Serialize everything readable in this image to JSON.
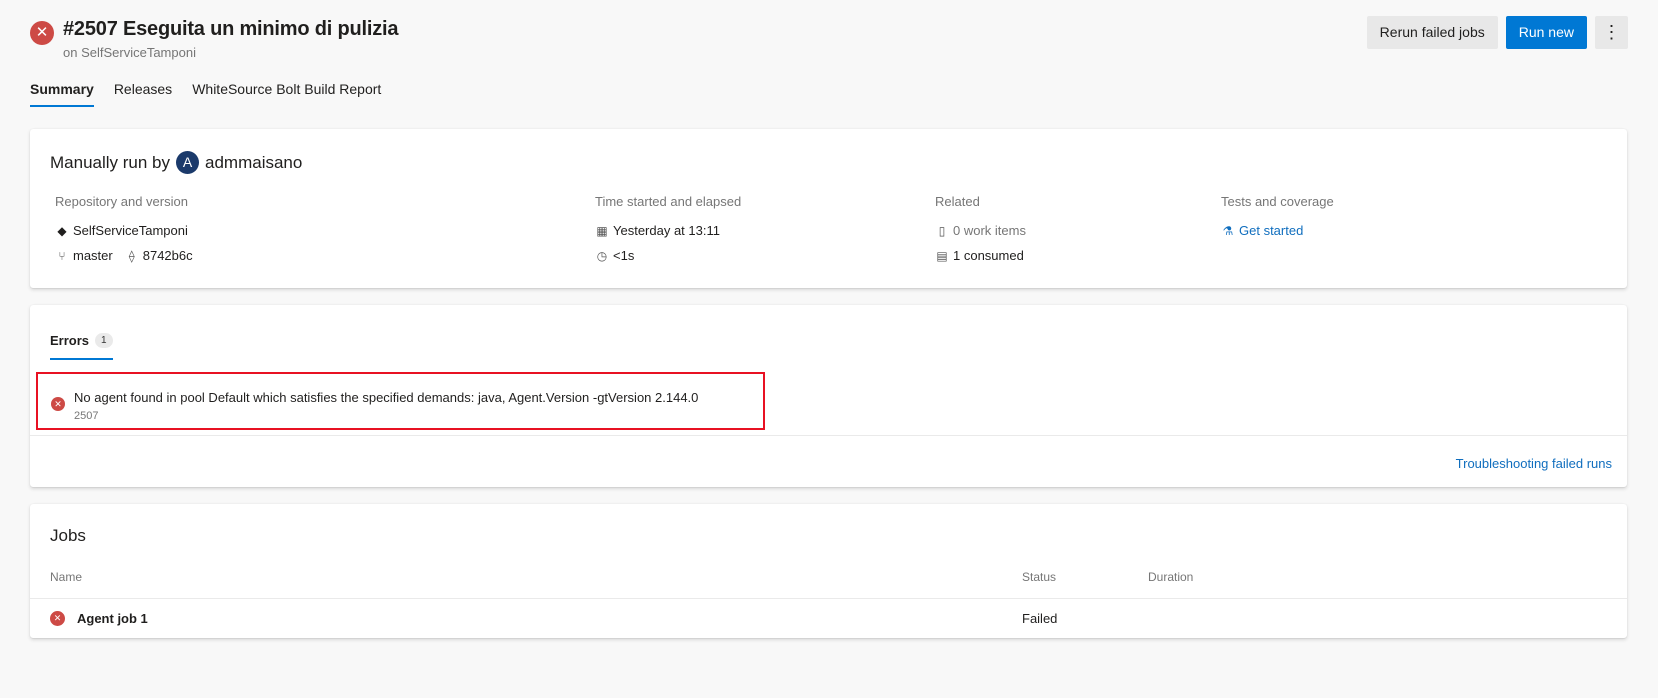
{
  "header": {
    "status_icon": "error-x",
    "title": "#2507 Eseguita un minimo di pulizia",
    "subtitle": "on SelfServiceTamponi",
    "rerun_label": "Rerun failed jobs",
    "run_new_label": "Run new",
    "more_label": "⋮"
  },
  "tabs": [
    {
      "label": "Summary",
      "active": true
    },
    {
      "label": "Releases",
      "active": false
    },
    {
      "label": "WhiteSource Bolt Build Report",
      "active": false
    }
  ],
  "summary": {
    "manual_prefix": "Manually run by",
    "avatar_initial": "A",
    "user": "admmaisano",
    "repo": {
      "label": "Repository and version",
      "name": "SelfServiceTamponi",
      "branch": "master",
      "commit": "8742b6c"
    },
    "time": {
      "label": "Time started and elapsed",
      "started": "Yesterday at 13:11",
      "elapsed": "<1s"
    },
    "related": {
      "label": "Related",
      "work_items": "0 work items",
      "consumed": "1 consumed"
    },
    "tests": {
      "label": "Tests and coverage",
      "get_started": "Get started"
    }
  },
  "errors": {
    "tab_label": "Errors",
    "count": "1",
    "items": [
      {
        "message": "No agent found in pool Default which satisfies the specified demands: java, Agent.Version -gtVersion 2.144.0",
        "sub": "2507"
      }
    ],
    "troubleshoot_label": "Troubleshooting failed runs"
  },
  "jobs": {
    "title": "Jobs",
    "columns": {
      "name": "Name",
      "status": "Status",
      "duration": "Duration"
    },
    "rows": [
      {
        "name": "Agent job 1",
        "status": "Failed",
        "duration": ""
      }
    ]
  },
  "colors": {
    "accent": "#0078d4",
    "error": "#cd4a45",
    "highlight_border": "#e81123",
    "link": "#106ebe"
  }
}
